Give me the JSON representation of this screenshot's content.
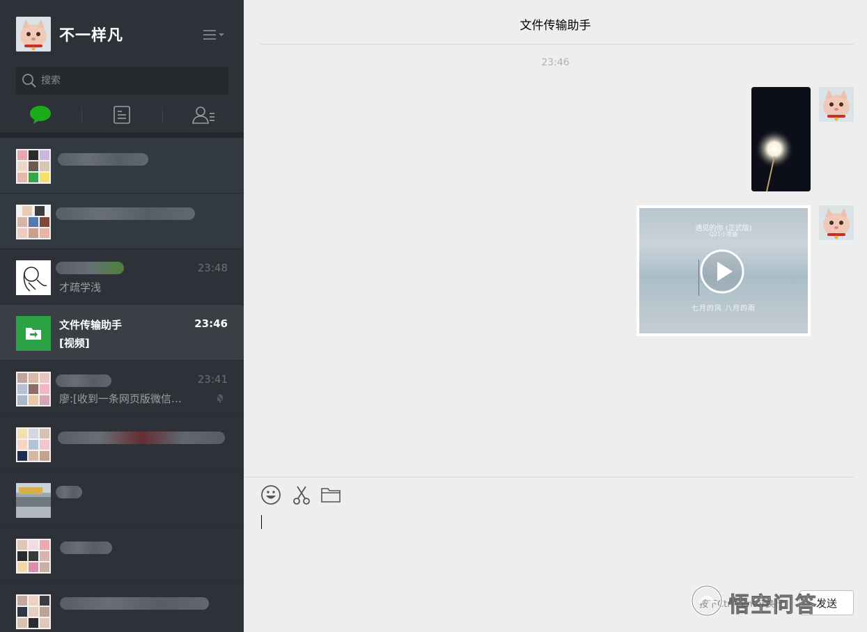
{
  "profile": {
    "name": "不一样凡"
  },
  "search": {
    "placeholder": "搜索"
  },
  "chats": [
    {
      "name": "",
      "preview": "",
      "time": ""
    },
    {
      "name": "",
      "preview": "",
      "time": ""
    },
    {
      "name": "",
      "preview": "才疏学浅",
      "time": "23:48"
    },
    {
      "name": "文件传输助手",
      "preview": "[视频]",
      "time": "23:46",
      "active": true
    },
    {
      "name": "",
      "preview": "廖:[收到一条网页版微信…",
      "time": "23:41",
      "muted": true
    },
    {
      "name": "",
      "preview": "",
      "time": ""
    },
    {
      "name": "",
      "preview": "",
      "time": ""
    },
    {
      "name": "",
      "preview": "",
      "time": ""
    },
    {
      "name": "",
      "preview": "",
      "time": ""
    }
  ],
  "chat": {
    "title": "文件传输助手",
    "timestamp": "23:46",
    "video_card": {
      "title": "遇见的你 (正式版)",
      "subtitle": "Q21小夜曲",
      "lyric": "七月的风 八月的雨"
    }
  },
  "composer": {
    "hint": "按下Ctrl+Enter换行",
    "send_label": "发送",
    "tools": [
      "emoji-icon",
      "scissors-icon",
      "folder-icon"
    ]
  },
  "watermark": {
    "text": "悟空问答"
  },
  "colors": {
    "sidebar": "#2e3238",
    "accent_green": "#1aad19",
    "file_helper": "#2ba245",
    "background": "#eeeeee"
  }
}
